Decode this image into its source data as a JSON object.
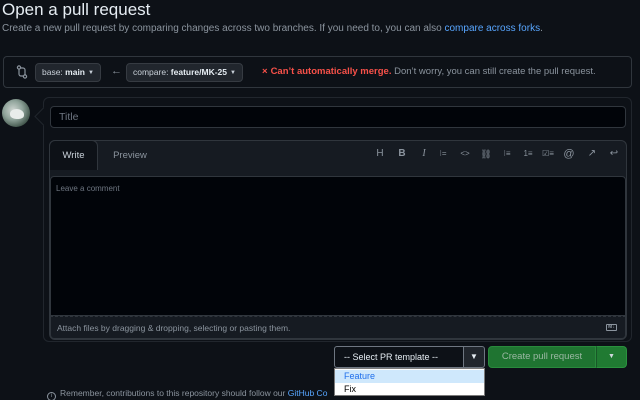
{
  "header": {
    "title": "Open a pull request",
    "subtitle_prefix": "Create a new pull request by comparing changes across two branches. If you need to, you can also ",
    "subtitle_link": "compare across forks",
    "subtitle_suffix": "."
  },
  "range": {
    "base_prefix": "base: ",
    "base_branch": "main",
    "compare_prefix": "compare: ",
    "compare_branch": "feature/MK-25",
    "merge_icon": "×",
    "merge_status": "Can’t automatically merge.",
    "merge_hint": " Don’t worry, you can still create the pull request."
  },
  "form": {
    "title_placeholder": "Title",
    "tabs": {
      "write": "Write",
      "preview": "Preview"
    },
    "comment_placeholder": "Leave a comment",
    "attach_text": "Attach files by dragging & dropping, selecting or pasting them.",
    "markdown_badge": "M↓"
  },
  "toolbar": {
    "heading": "H",
    "bold": "B",
    "italic": "I",
    "quote": "⁝=",
    "code": "<>",
    "link": "⛓",
    "bullet_list": "⁝≡",
    "numbered_list": "1≡",
    "task_list": "☑≡",
    "mention": "@",
    "reference": "↗",
    "reply": "↩"
  },
  "template": {
    "selected": "-- Select PR template --",
    "arrow": "▼",
    "options": [
      "Feature",
      "Fix"
    ]
  },
  "actions": {
    "create_label": "Create pull request",
    "caret": "▼"
  },
  "footer": {
    "info_icon": "i",
    "text": "Remember, contributions to this repository should follow our ",
    "link": "GitHub Co"
  },
  "colors": {
    "background": "#0d1117",
    "accent_link": "#58a6ff",
    "error": "#f85149",
    "primary_button": "#238636"
  },
  "icons": [
    "git-compare-icon",
    "arrow-left-icon",
    "x-icon",
    "markdown-icon",
    "info-icon"
  ]
}
